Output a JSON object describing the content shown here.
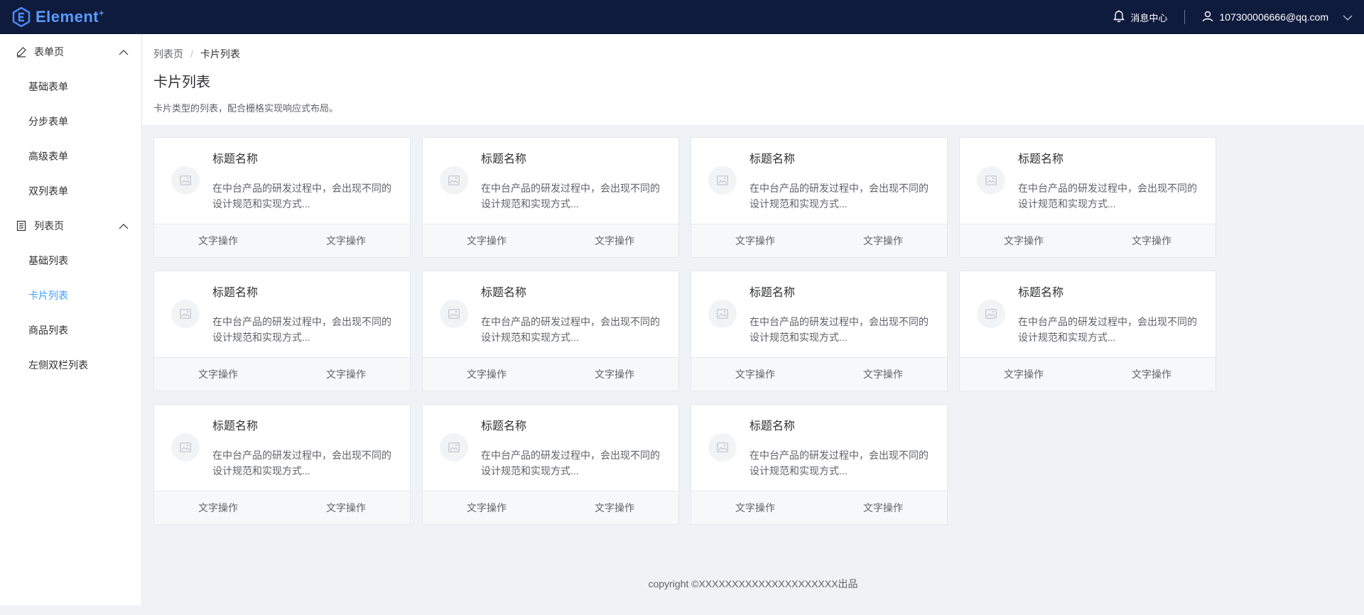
{
  "header": {
    "logo_text": "Element",
    "logo_plus": "+",
    "messages_label": "消息中心",
    "user_email": "107300006666@qq.com"
  },
  "sidebar": {
    "groups": [
      {
        "label": "表单页",
        "icon": "edit-icon",
        "items": [
          "基础表单",
          "分步表单",
          "高级表单",
          "双列表单"
        ]
      },
      {
        "label": "列表页",
        "icon": "list-icon",
        "items": [
          "基础列表",
          "卡片列表",
          "商品列表",
          "左侧双栏列表"
        ]
      }
    ],
    "active_item": "卡片列表"
  },
  "breadcrumb": {
    "parent": "列表页",
    "separator": "/",
    "current": "卡片列表"
  },
  "page": {
    "title": "卡片列表",
    "description": "卡片类型的列表，配合栅格实现响应式布局。"
  },
  "cards": [
    {
      "title": "标题名称",
      "desc": "在中台产品的研发过程中，会出现不同的设计规范和实现方式...",
      "action1": "文字操作",
      "action2": "文字操作"
    },
    {
      "title": "标题名称",
      "desc": "在中台产品的研发过程中，会出现不同的设计规范和实现方式...",
      "action1": "文字操作",
      "action2": "文字操作"
    },
    {
      "title": "标题名称",
      "desc": "在中台产品的研发过程中，会出现不同的设计规范和实现方式...",
      "action1": "文字操作",
      "action2": "文字操作"
    },
    {
      "title": "标题名称",
      "desc": "在中台产品的研发过程中，会出现不同的设计规范和实现方式...",
      "action1": "文字操作",
      "action2": "文字操作"
    },
    {
      "title": "标题名称",
      "desc": "在中台产品的研发过程中，会出现不同的设计规范和实现方式...",
      "action1": "文字操作",
      "action2": "文字操作"
    },
    {
      "title": "标题名称",
      "desc": "在中台产品的研发过程中，会出现不同的设计规范和实现方式...",
      "action1": "文字操作",
      "action2": "文字操作"
    },
    {
      "title": "标题名称",
      "desc": "在中台产品的研发过程中，会出现不同的设计规范和实现方式...",
      "action1": "文字操作",
      "action2": "文字操作"
    },
    {
      "title": "标题名称",
      "desc": "在中台产品的研发过程中，会出现不同的设计规范和实现方式...",
      "action1": "文字操作",
      "action2": "文字操作"
    },
    {
      "title": "标题名称",
      "desc": "在中台产品的研发过程中，会出现不同的设计规范和实现方式...",
      "action1": "文字操作",
      "action2": "文字操作"
    },
    {
      "title": "标题名称",
      "desc": "在中台产品的研发过程中，会出现不同的设计规范和实现方式...",
      "action1": "文字操作",
      "action2": "文字操作"
    },
    {
      "title": "标题名称",
      "desc": "在中台产品的研发过程中，会出现不同的设计规范和实现方式...",
      "action1": "文字操作",
      "action2": "文字操作"
    }
  ],
  "footer": {
    "text": "copyright ©XXXXXXXXXXXXXXXXXXXXX出品"
  },
  "colors": {
    "header_bg": "#0f1b3d",
    "accent": "#409eff",
    "page_bg": "#f0f2f5"
  }
}
